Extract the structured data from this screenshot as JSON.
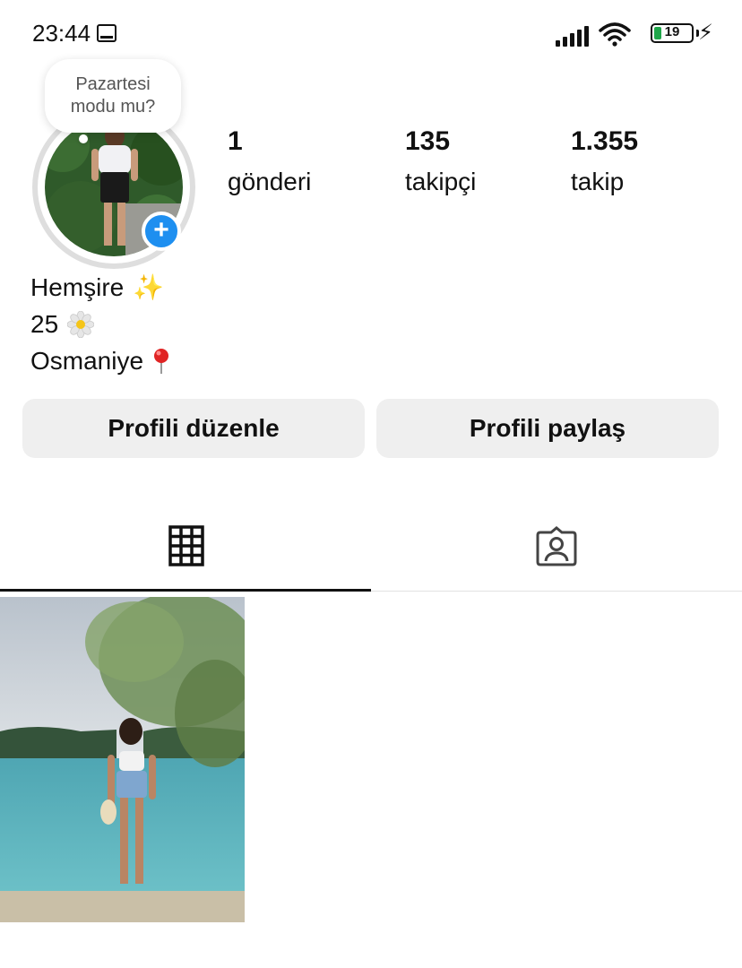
{
  "status_bar": {
    "time": "23:44",
    "battery": "19",
    "icons": [
      "screen-record-icon",
      "signal-icon",
      "wifi-icon",
      "battery-icon",
      "charging-icon"
    ]
  },
  "note": {
    "text_line1": "Pazartesi",
    "text_line2": "modu mu?"
  },
  "stats": [
    {
      "value": "1",
      "label": "gönderi"
    },
    {
      "value": "135",
      "label": "takipçi"
    },
    {
      "value": "1.355",
      "label": "takip"
    }
  ],
  "bio": {
    "line1": "Hemşire",
    "line2": "25",
    "line3": "Osmaniye"
  },
  "buttons": {
    "edit_profile": "Profili düzenle",
    "share_profile": "Profili paylaş"
  },
  "tabs": [
    "grid-icon",
    "tagged-icon"
  ],
  "colors": {
    "accent": "#1e8ff0",
    "button_bg": "#efefef"
  }
}
